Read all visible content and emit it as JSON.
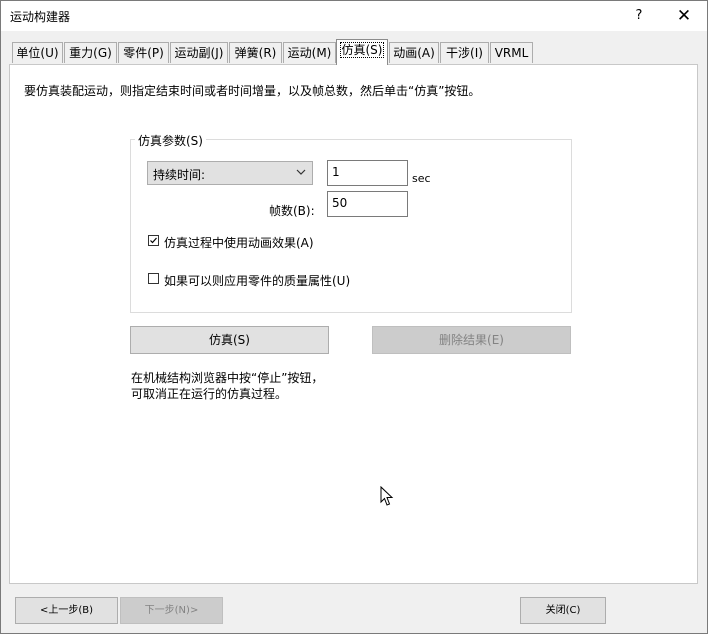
{
  "window": {
    "title": "运动构建器",
    "help_label": "?",
    "close_label": "✕"
  },
  "tabs": [
    {
      "label": "单位(U)"
    },
    {
      "label": "重力(G)"
    },
    {
      "label": "零件(P)"
    },
    {
      "label": "运动副(J)"
    },
    {
      "label": "弹簧(R)"
    },
    {
      "label": "运动(M)"
    },
    {
      "label": "仿真(S)",
      "active": true
    },
    {
      "label": "动画(A)"
    },
    {
      "label": "干涉(I)"
    },
    {
      "label": "VRML"
    }
  ],
  "panel": {
    "description": "要仿真装配运动，则指定结束时间或者时间增量，以及帧总数，然后单击“仿真”按钮。",
    "group_title": "仿真参数(S)",
    "time_mode": {
      "selected": "持续时间:"
    },
    "time_value": "1",
    "time_unit": "sec",
    "frames_label": "帧数(B):",
    "frames_value": "50",
    "animate_checkbox": {
      "label": "仿真过程中使用动画效果(A)",
      "checked": true
    },
    "mass_checkbox": {
      "label": "如果可以则应用零件的质量属性(U)",
      "checked": false
    },
    "simulate_button": "仿真(S)",
    "delete_results_button": "删除结果(E)",
    "note_line1": "在机械结构浏览器中按“停止”按钮，",
    "note_line2": "可取消正在运行的仿真过程。"
  },
  "footer": {
    "prev_button": "<上一步(B)",
    "next_button": "下一步(N)>",
    "close_button": "关闭(C)"
  }
}
